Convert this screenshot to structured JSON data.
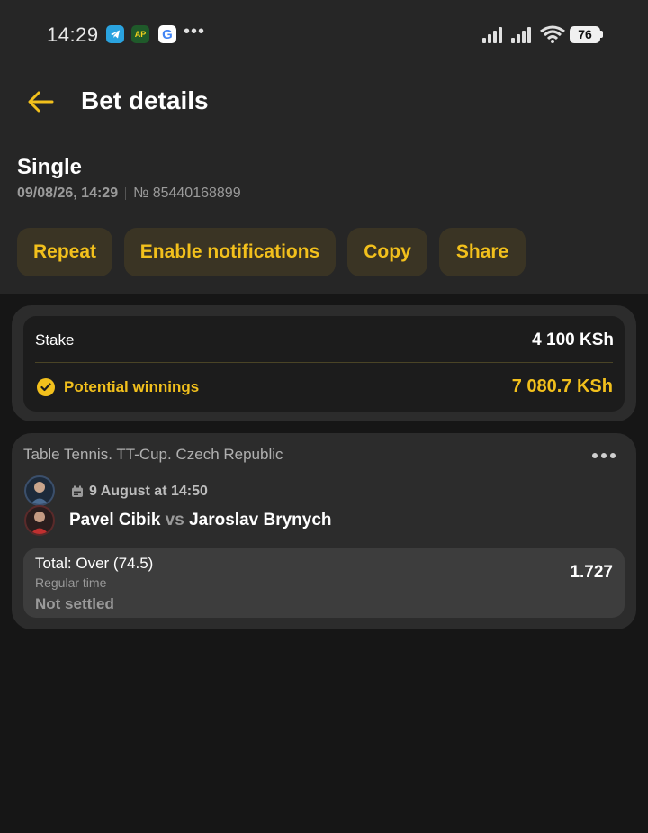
{
  "status_bar": {
    "time": "14:29",
    "app_icons": [
      "telegram-icon",
      "ap-icon",
      "google-icon"
    ],
    "ap_label": "AP",
    "google_label": "G",
    "more": "•••",
    "battery": "76"
  },
  "header": {
    "title": "Bet details",
    "back_icon": "arrow-left-icon"
  },
  "bet": {
    "type": "Single",
    "date": "09/08/26, 14:29",
    "number": "№ 85440168899"
  },
  "actions": {
    "repeat": "Repeat",
    "notifications": "Enable notifications",
    "copy": "Copy",
    "share": "Share"
  },
  "stake": {
    "label": "Stake",
    "value": "4 100 KSh",
    "winnings_label": "Potential winnings",
    "winnings_value": "7 080.7 KSh"
  },
  "event": {
    "league": "Table Tennis. TT-Cup. Czech Republic",
    "date": "9 August at 14:50",
    "team1": "Pavel Cibik",
    "vs": "vs",
    "team2": "Jaroslav Brynych",
    "market": "Total: Over (74.5)",
    "period": "Regular time",
    "status": "Not settled",
    "odds": "1.727"
  },
  "colors": {
    "accent": "#f2c01c",
    "background": "#161616",
    "panel": "#262626",
    "card": "#2c2c2c",
    "button_bg": "#3a3424"
  }
}
